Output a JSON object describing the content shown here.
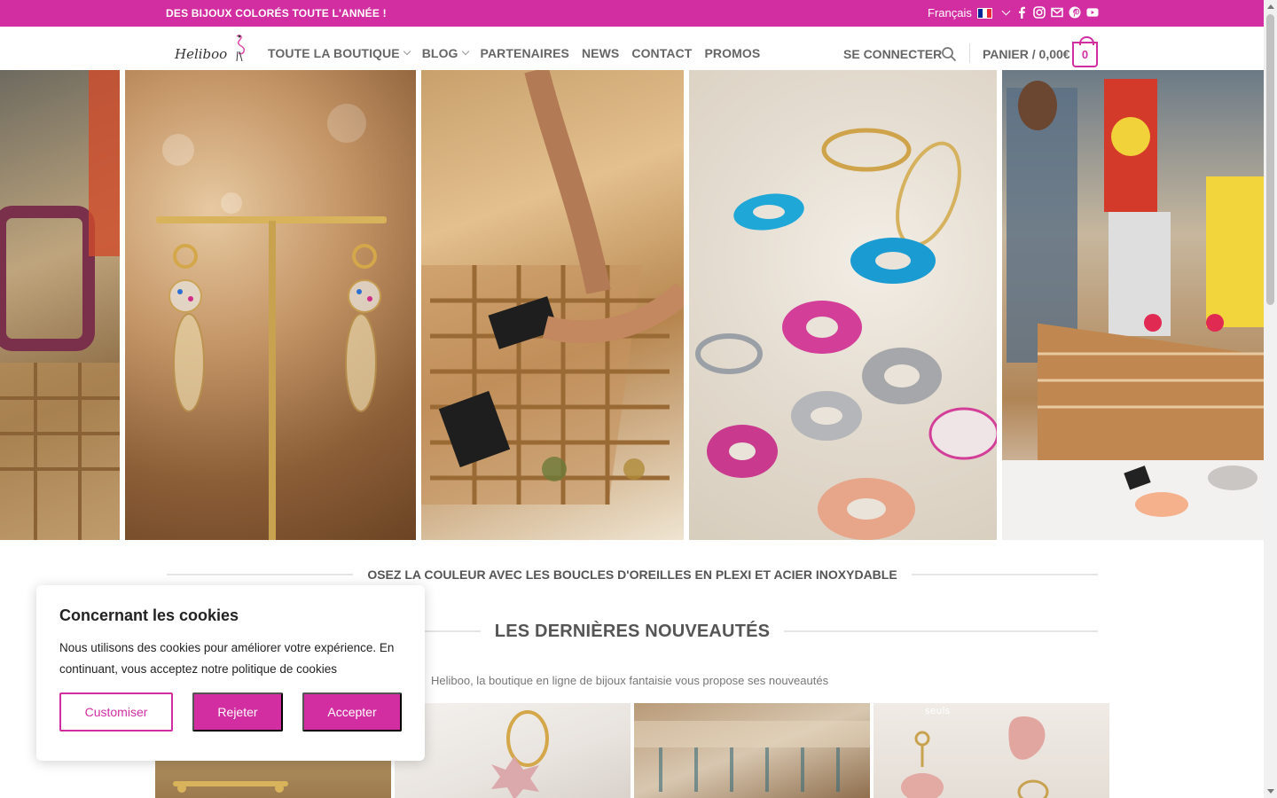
{
  "topbar": {
    "message": "DES BIJOUX COLORÉS TOUTE L'ANNÉE !",
    "language": "Français",
    "flag_colors": [
      "#002395",
      "#ffffff",
      "#ed2939"
    ],
    "social_icons": [
      "facebook-icon",
      "instagram-icon",
      "email-icon",
      "pinterest-icon",
      "youtube-icon"
    ],
    "background_color": "#d22ea2"
  },
  "header": {
    "logo_text": "Heliboo",
    "nav": [
      {
        "label": "TOUTE LA BOUTIQUE",
        "has_dropdown": true
      },
      {
        "label": "BLOG",
        "has_dropdown": true
      },
      {
        "label": "PARTENAIRES",
        "has_dropdown": false
      },
      {
        "label": "NEWS",
        "has_dropdown": false
      },
      {
        "label": "CONTACT",
        "has_dropdown": false
      },
      {
        "label": "PROMOS",
        "has_dropdown": false
      }
    ],
    "login_label": "SE CONNECTER",
    "cart_label": "PANIER / 0,00€",
    "cart_count": "0",
    "accent_color": "#d22ea2"
  },
  "hero": {
    "photos": [
      "market-stall-photo",
      "earrings-on-stand-photo",
      "jewelry-tray-photo",
      "plexi-rings-photo",
      "market-customers-photo"
    ]
  },
  "sections": {
    "tagline": "OSEZ LA COULEUR AVEC LES BOUCLES D'OREILLES EN PLEXI ET ACIER INOXYDABLE",
    "new_title": "LES DERNIÈRES NOUVEAUTÉS",
    "new_subtitle": "Heliboo, la boutique en ligne de bijoux fantaisie vous propose ses nouveautés"
  },
  "products": {
    "items": [
      "product-image-1",
      "product-image-2",
      "product-image-3",
      "product-image-4"
    ],
    "overlay_text": "seuls"
  },
  "cookie": {
    "title": "Concernant les cookies",
    "text": "Nous utilisons des cookies pour améliorer votre expérience. En continuant, vous acceptez notre politique de cookies",
    "customize_label": "Customiser",
    "reject_label": "Rejeter",
    "accept_label": "Accepter"
  }
}
